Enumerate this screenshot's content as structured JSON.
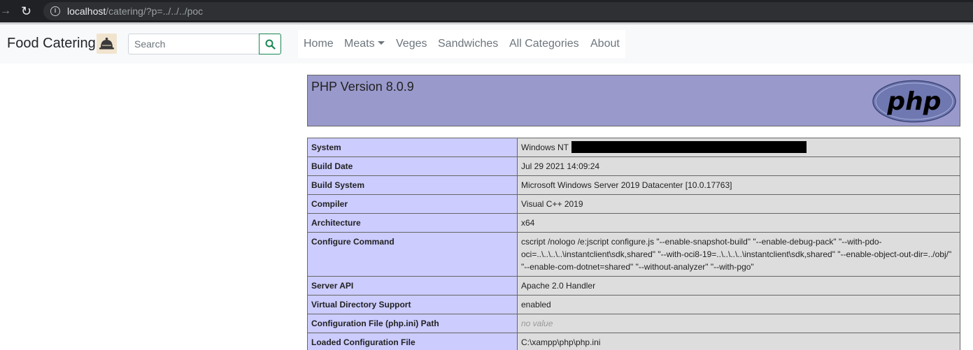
{
  "browser": {
    "url_host": "localhost",
    "url_path": "/catering/?p=../../../poc"
  },
  "navbar": {
    "brand": "Food Catering",
    "logo_text": "Catering",
    "search_placeholder": "Search",
    "links": [
      "Home",
      "Meats",
      "Veges",
      "Sandwiches",
      "All Categories",
      "About"
    ],
    "search_button_color": "#198754"
  },
  "phpinfo": {
    "title": "PHP Version 8.0.9",
    "logo_text": "php",
    "rows": [
      {
        "key": "System",
        "value": "Windows NT"
      },
      {
        "key": "Build Date",
        "value": "Jul 29 2021 14:09:24"
      },
      {
        "key": "Build System",
        "value": "Microsoft Windows Server 2019 Datacenter [10.0.17763]"
      },
      {
        "key": "Compiler",
        "value": "Visual C++ 2019"
      },
      {
        "key": "Architecture",
        "value": "x64"
      },
      {
        "key": "Configure Command",
        "value": "cscript /nologo /e:jscript configure.js \"--enable-snapshot-build\" \"--enable-debug-pack\" \"--with-pdo-oci=..\\..\\..\\..\\instantclient\\sdk,shared\" \"--with-oci8-19=..\\..\\..\\..\\instantclient\\sdk,shared\" \"--enable-object-out-dir=../obj/\" \"--enable-com-dotnet=shared\" \"--without-analyzer\" \"--with-pgo\""
      },
      {
        "key": "Server API",
        "value": "Apache 2.0 Handler"
      },
      {
        "key": "Virtual Directory Support",
        "value": "enabled"
      },
      {
        "key": "Configuration File (php.ini) Path",
        "value": "no value"
      },
      {
        "key": "Loaded Configuration File",
        "value": "C:\\xampp\\php\\php.ini"
      }
    ],
    "colors": {
      "header": "#9999cc",
      "key_cell": "#ccccff",
      "value_cell": "#dddddd"
    }
  }
}
